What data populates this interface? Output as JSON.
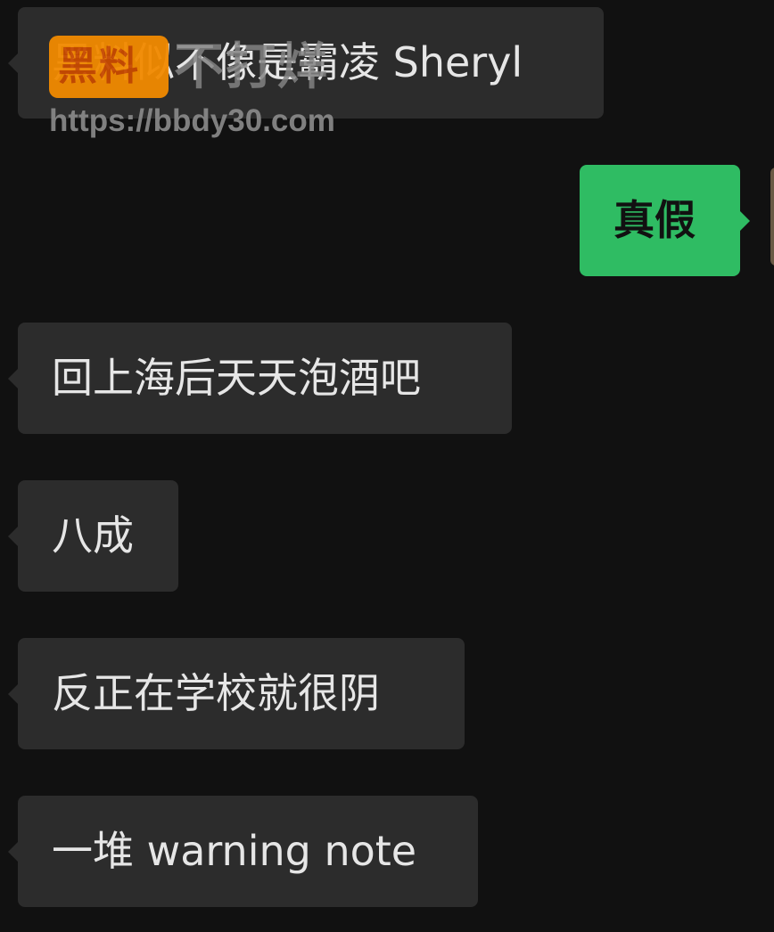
{
  "chat": {
    "messages": [
      {
        "side": "incoming",
        "text": "黑料似不像是霸凌 Sheryl"
      },
      {
        "side": "outgoing",
        "text": "真假"
      },
      {
        "side": "incoming",
        "text": "回上海后天天泡酒吧"
      },
      {
        "side": "incoming",
        "text": "八成"
      },
      {
        "side": "incoming",
        "text": "反正在学校就很阴"
      },
      {
        "side": "incoming",
        "text": "一堆 warning note"
      }
    ]
  },
  "watermark": {
    "logo_text": "黑料",
    "title": "不打烊",
    "url": "https://bbdy30.com"
  },
  "colors": {
    "background": "#111111",
    "incoming_bubble": "#2c2c2c",
    "outgoing_bubble": "#2fbc63",
    "watermark_logo": "#f28a00"
  }
}
